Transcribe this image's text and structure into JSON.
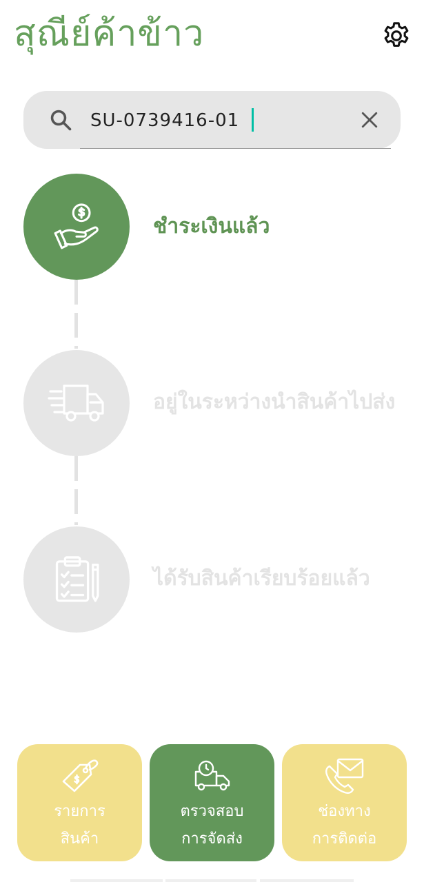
{
  "header": {
    "app_title": "สุณีย์ค้าข้าว",
    "settings_icon": "gear-icon"
  },
  "search": {
    "value": "SU-0739416-01",
    "search_icon": "search-icon",
    "clear_icon": "close-icon"
  },
  "steps": [
    {
      "label": "ชำระเงินแล้ว",
      "icon": "hand-coin-icon",
      "state": "active"
    },
    {
      "label": "อยู่ในระหว่างนำสินค้าไปส่ง",
      "icon": "delivery-truck-icon",
      "state": "inactive"
    },
    {
      "label": "ได้รับสินค้าเรียบร้อยแล้ว",
      "icon": "clipboard-checklist-icon",
      "state": "inactive"
    }
  ],
  "bottom_nav": [
    {
      "line1": "รายการ",
      "line2": "สินค้า",
      "icon": "price-tag-icon",
      "state": "inactive"
    },
    {
      "line1": "ตรวจสอบ",
      "line2": "การจัดส่ง",
      "icon": "truck-clock-icon",
      "state": "active"
    },
    {
      "line1": "ช่องทาง",
      "line2": "การติดต่อ",
      "icon": "phone-mail-icon",
      "state": "inactive"
    }
  ],
  "colors": {
    "brand_green": "#62975a",
    "accent_yellow": "#f2e08c",
    "inactive_gray": "#e6e6e6",
    "caret_teal": "#00bfa5"
  }
}
